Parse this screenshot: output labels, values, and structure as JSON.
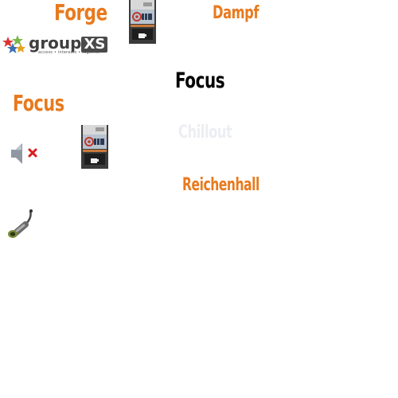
{
  "labels": {
    "forge": "Forge",
    "dampf": "Dampf",
    "focus_center": "Focus",
    "focus_left": "Focus",
    "chillout": "Chillout",
    "reichenhall": "Reichenhall"
  },
  "logo": {
    "word": "group",
    "xs": "XS",
    "tagline": "access • interests • together"
  },
  "icons": {
    "cafe_box": "coffee-machine-icon",
    "mute": "speaker-muted-icon",
    "tap": "beer-tap-icon"
  },
  "colors": {
    "orange": "#e87a1e",
    "black": "#000000",
    "ghost": "#eceef2"
  }
}
